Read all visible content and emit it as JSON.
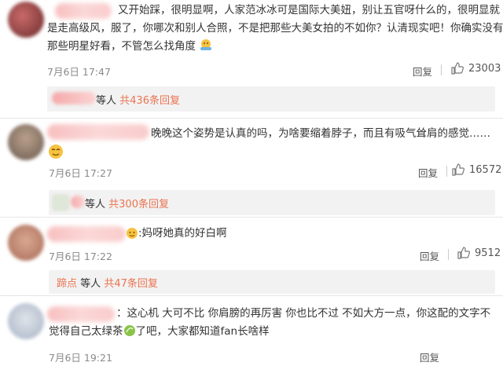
{
  "comments": [
    {
      "lines": [
        "又开始踩，很明显啊，人家范冰冰可是国际大美妞，别让五官呀什么的，很明显就",
        "是走高级风，服了，你哪次和别人合照，不是把那些大美女拍的不如你？认清现实吧！你确实没有",
        "那些明星好看，不管怎么找角度"
      ],
      "date": "7月6日 17:47",
      "reply_label": "回复",
      "likes": "23003",
      "sub": {
        "prefix": "等人",
        "count": "共436条回复"
      }
    },
    {
      "lines": [
        "晚晚这个姿势是认真的吗，为啥要缩着脖子，而且有吸气耸肩的感觉……"
      ],
      "date": "7月6日 17:27",
      "reply_label": "回复",
      "likes": "16572",
      "sub": {
        "prefix": "等人",
        "count": "共300条回复"
      }
    },
    {
      "lines": [
        ":妈呀她真的好白啊"
      ],
      "date": "7月6日 17:22",
      "reply_label": "回复",
      "likes": "9512",
      "sub": {
        "lead": "蹄点",
        "prefix": "等人",
        "count": "共47条回复"
      }
    },
    {
      "lines": [
        "：这心机  大可不比 你肩膀的再厉害 你也比不过  不如大方一点，你这配的文字不",
        "觉得自己太绿茶",
        "了吧，大家都知道fan长啥样"
      ],
      "date": "7月6日 19:21",
      "reply_label": "回复"
    }
  ],
  "colors": {
    "accent": "#eb7350",
    "meta": "#8a8a8a",
    "subbg": "#f2f2f2"
  }
}
